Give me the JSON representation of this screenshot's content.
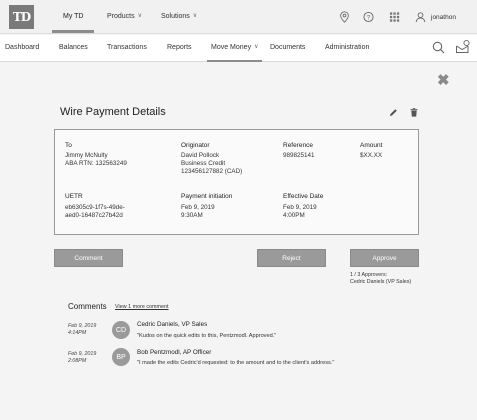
{
  "brand": {
    "logo_text": "TD"
  },
  "top_nav": {
    "items": [
      {
        "label": "My TD"
      },
      {
        "label": "Products"
      },
      {
        "label": "Solutions"
      }
    ],
    "icons": [
      "location-icon",
      "help-icon",
      "apps-grid-icon",
      "user-icon"
    ],
    "user_name": "jonathon"
  },
  "sub_nav": {
    "items": [
      {
        "label": "Dashboard"
      },
      {
        "label": "Balances"
      },
      {
        "label": "Transactions"
      },
      {
        "label": "Reports"
      },
      {
        "label": "Move Money"
      },
      {
        "label": "Documents"
      },
      {
        "label": "Administration"
      }
    ],
    "active": "Move Money"
  },
  "page": {
    "title": "Wire Payment Details",
    "close_icon": "close-icon"
  },
  "details": {
    "to": {
      "label": "To",
      "value": "Jimmy McNulty\nABA RTN: 132563249"
    },
    "originator": {
      "label": "Originator",
      "value": "David Pollock\nBusiness Credit\n123456127882 (CAD)"
    },
    "reference": {
      "label": "Reference",
      "value": "989825141"
    },
    "amount": {
      "label": "Amount",
      "value": "$XX.XX"
    },
    "uetr": {
      "label": "UETR",
      "value": "eb6305c9-1f7s-49de-\naed0-16487c27b42d"
    },
    "payment_initiation": {
      "label": "Payment initiation",
      "value": "Feb 9, 2019\n9:30AM"
    },
    "effective_date": {
      "label": "Effective Date",
      "value": "Feb 9, 2019\n4:00PM"
    }
  },
  "actions": {
    "comment": "Comment",
    "reject": "Reject",
    "approve": "Approve",
    "approvers_count": "1 / 3 Approvers:",
    "approvers_names": "Cedric Daniels (VP Sales)"
  },
  "comments": {
    "title": "Comments",
    "view_more": "View 1 more comment",
    "items": [
      {
        "date": "Feb 9, 2019",
        "time": "4:14PM",
        "initials": "CD",
        "author": "Cedric Daniels, VP Sales",
        "text": "\"Kudos on the quick edits to this, Pentzmodl. Approved.\""
      },
      {
        "date": "Feb 9, 2019",
        "time": "2:08PM",
        "initials": "BP",
        "author": "Bob Pentzmodl, AP Officer",
        "text": "\"I made the edits Cedric'd requested: to the amount and to the client's address.\""
      }
    ]
  }
}
